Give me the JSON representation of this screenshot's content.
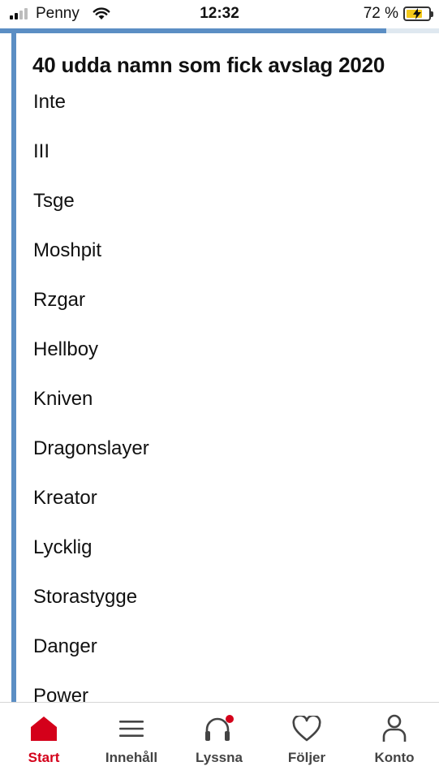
{
  "status_bar": {
    "carrier": "Penny",
    "time": "12:32",
    "battery_percent": "72 %",
    "battery_level": 0.72
  },
  "page_load_progress": 0.88,
  "article": {
    "title": "40 udda namn som fick avslag 2020",
    "names": [
      "Inte",
      "III",
      "Tsge",
      "Moshpit",
      "Rzgar",
      "Hellboy",
      "Kniven",
      "Dragonslayer",
      "Kreator",
      "Lycklig",
      "Storastygge",
      "Danger",
      "Power"
    ]
  },
  "tab_bar": {
    "items": [
      {
        "label": "Start",
        "icon": "home-icon",
        "active": true
      },
      {
        "label": "Innehåll",
        "icon": "menu-icon",
        "active": false
      },
      {
        "label": "Lyssna",
        "icon": "headphones-icon",
        "active": false,
        "badge": true
      },
      {
        "label": "Följer",
        "icon": "heart-icon",
        "active": false
      },
      {
        "label": "Konto",
        "icon": "person-icon",
        "active": false
      }
    ]
  },
  "colors": {
    "accent_red": "#d4001a",
    "quote_blue": "#5b8ec4"
  }
}
